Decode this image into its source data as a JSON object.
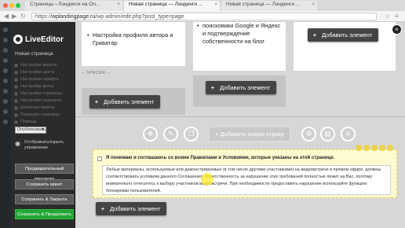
{
  "browser": {
    "tabs": [
      "Страницы ‹ Лэндинги на Оn...",
      "Новая страница — Лэндинги ...",
      "Новая страница — Лэндинги ..."
    ],
    "url_host": "wplandingpage.ru",
    "url_path": "/wp-admin/edit.php?post_type=page",
    "url_prefix": "https://"
  },
  "editor": {
    "logo_text": "LiveEditor",
    "page_title": "Новая страница",
    "menu": [
      "Настройки макета",
      "Настройки цвета",
      "Настройки шрифта",
      "Настройки фона",
      "Настройки страницы",
      "Настройки подписки",
      "Шаблоны макета",
      "Редакция страницы",
      "Помощь"
    ],
    "status_select": "Опубликовать",
    "toggle_label": "Отображать/скрыть управление",
    "buttons": {
      "preview": "Предварительный просмотр",
      "save_layout": "Сохранить макет",
      "save_close": "Сохранить & Закрыть",
      "save_continue": "Сохранить & Продолжить"
    }
  },
  "canvas": {
    "col1_items": [
      "Настройка профиля автора и Граватар"
    ],
    "col2_items": [
      "поисковики Google и Яндекс и подтверждение собственности на блог"
    ],
    "spacer_label": "-- SPACER --",
    "add_element": "Добавить элемент",
    "add_row": "Добавить новую строку",
    "agree_title": "Я понимаю и соглашаюсь со всеми Правилами и Условиями, которые указаны на этой странице.",
    "agree_text": "Любые материалы, используемые или демонстрируемые (в том числе другими участниками) на видеовстрече в прямом эфире, должны соответствовать условиям данного Соглашения. Ответственность за нарушение этих требований полностью лежит на Вас, поэтому внимательно отнеситесь к выбору участников видеовстречи. При необходимости предоставить нарушение используйте функцию блокировки пользователей."
  }
}
